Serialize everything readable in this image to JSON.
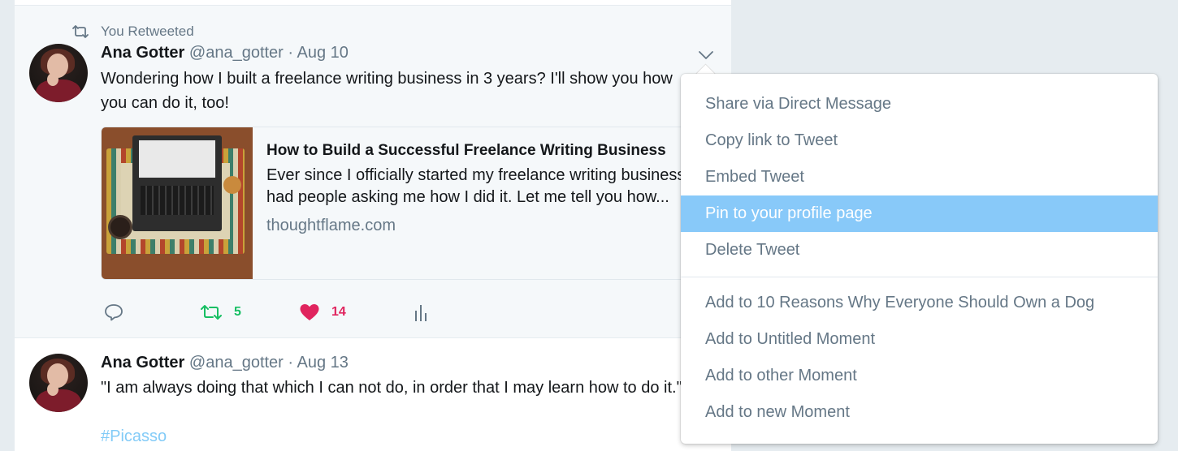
{
  "retweet_label": "You Retweeted",
  "tweets": [
    {
      "name": "Ana Gotter",
      "handle_date": "@ana_gotter · Aug 10",
      "text": "Wondering how I built a freelance writing business in 3 years? I'll show you how you can do it, too!",
      "card": {
        "title": "How to Build a Successful Freelance Writing Business",
        "description": "Ever since I officially started my freelance writing business, I’ve had people asking me how I did it. Let me tell you how...",
        "domain": "thoughtflame.com"
      },
      "actions": {
        "retweets": "5",
        "likes": "14"
      }
    },
    {
      "name": "Ana Gotter",
      "handle_date": "@ana_gotter · Aug 13",
      "text": "\"I am always doing that which I can not do, in order that I may learn how to do it.\"",
      "hashtag": "#Picasso"
    }
  ],
  "menu": {
    "items": [
      "Share via Direct Message",
      "Copy link to Tweet",
      "Embed Tweet",
      "Pin to your profile page",
      "Delete Tweet"
    ],
    "moments": [
      "Add to 10 Reasons Why Everyone Should Own a Dog",
      "Add to Untitled Moment",
      "Add to other Moment",
      "Add to new Moment"
    ],
    "highlighted": "Pin to your profile page"
  },
  "colors": {
    "retweet_green": "#17bf63",
    "like_red": "#e0245e",
    "link_blue": "#1da1f2",
    "highlight": "#88c9f9"
  },
  "icons": [
    "retweet-icon",
    "caret-down-icon",
    "reply-icon",
    "heart-icon",
    "analytics-icon"
  ]
}
